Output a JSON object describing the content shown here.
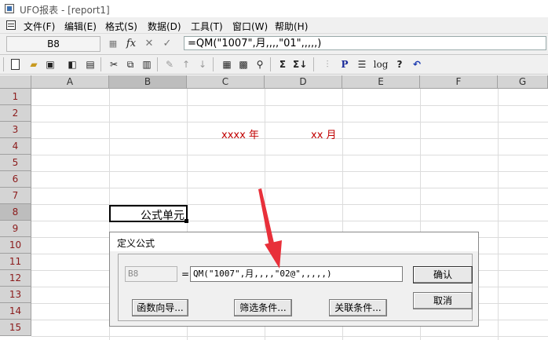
{
  "window": {
    "title": "UFO报表 - [report1]"
  },
  "menu": {
    "items": [
      "文件(F)",
      "编辑(E)",
      "格式(S)",
      "数据(D)",
      "工具(T)",
      "窗口(W)",
      "帮助(H)"
    ]
  },
  "formula_bar": {
    "cell_ref": "B8",
    "fx_icon": "fx",
    "cancel_icon": "✕",
    "confirm_icon": "✓",
    "formula": "=QM(\"1007\",月,,,,\"01\",,,,,)"
  },
  "toolbar": {
    "tool_labels": {
      "sum": "Σ",
      "sum_down": "Σ↓",
      "pointer": "P",
      "log": "log",
      "help": "?",
      "undo": "↶"
    }
  },
  "grid": {
    "columns": [
      "A",
      "B",
      "C",
      "D",
      "E",
      "F",
      "G"
    ],
    "rows": [
      "1",
      "2",
      "3",
      "4",
      "5",
      "6",
      "7",
      "8",
      "9",
      "10",
      "11",
      "12",
      "13",
      "14",
      "15"
    ],
    "selected_column": "B",
    "selected_row": "8",
    "cells": {
      "c3": "xxxx 年",
      "d3": "xx 月",
      "b8": "公式单元"
    }
  },
  "dialog": {
    "title": "定义公式",
    "cell_ref": "B8",
    "equals": "=",
    "formula": "QM(\"1007\",月,,,,\"02@\",,,,,)",
    "buttons": {
      "confirm": "确认",
      "cancel": "取消",
      "function_wizard": "函数向导...",
      "filter": "筛选条件...",
      "relation": "关联条件..."
    }
  },
  "colors": {
    "accent_red": "#c00000",
    "arrow_red": "#e8303a"
  }
}
